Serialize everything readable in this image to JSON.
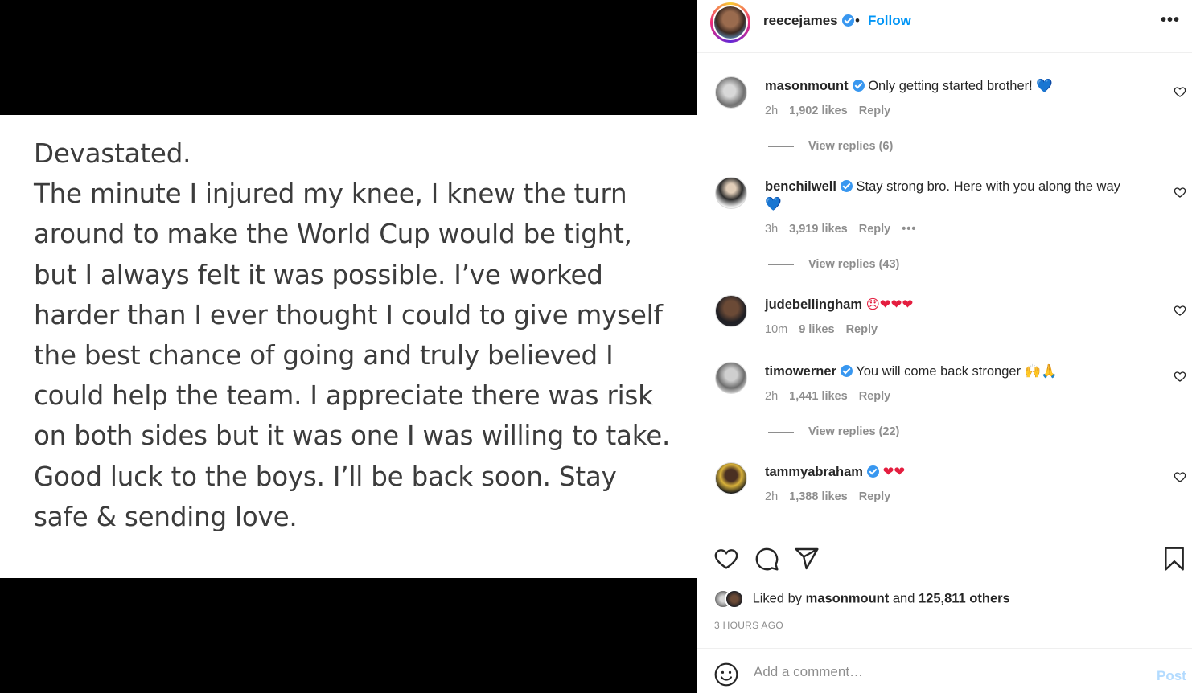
{
  "post": {
    "note_lines": [
      "Devastated.",
      "The minute I injured my knee, I knew the turn",
      "around to make the World Cup would be tight,",
      "but I always felt it was possible. I’ve worked",
      "harder than I ever thought I could to give myself",
      "the best chance of going and truly believed I",
      "could help the team.  I appreciate there was risk",
      "on both sides but it was one I was willing to take.",
      "Good luck to the boys. I’ll be back soon. Stay",
      "safe & sending love."
    ]
  },
  "header": {
    "username": "reecejames",
    "separator": "•",
    "follow_label": "Follow",
    "more_label": "•••"
  },
  "comments": [
    {
      "username": "masonmount",
      "text": "Only getting started brother!",
      "emojis": "💙",
      "time": "2h",
      "likes": "1,902 likes",
      "reply": "Reply",
      "view_replies": "View replies (6)"
    },
    {
      "username": "benchilwell",
      "text": "Stay strong bro. Here with you along the way",
      "emojis": "💙",
      "time": "3h",
      "likes": "3,919 likes",
      "reply": "Reply",
      "more": "•••",
      "view_replies": "View replies (43)"
    },
    {
      "username": "judebellingham",
      "text": "",
      "emojis": "😞❤❤❤",
      "time": "10m",
      "likes": "9 likes",
      "reply": "Reply"
    },
    {
      "username": "timowerner",
      "text": "You will come back stronger",
      "emojis": "🙌🙏",
      "time": "2h",
      "likes": "1,441 likes",
      "reply": "Reply",
      "view_replies": "View replies (22)"
    },
    {
      "username": "tammyabraham",
      "text": "",
      "emojis": "❤❤",
      "time": "2h",
      "likes": "1,388 likes",
      "reply": "Reply"
    }
  ],
  "liked_by": {
    "prefix": "Liked by",
    "user": "masonmount",
    "conjunction": "and",
    "others": "125,811 others"
  },
  "timestamp": "3 HOURS AGO",
  "add_comment": {
    "placeholder": "Add a comment…",
    "post_label": "Post"
  },
  "colors": {
    "accent": "#0095f6",
    "verified": "#3897f0",
    "post_disabled": "#b3dbff",
    "muted": "#8e8e8e"
  }
}
